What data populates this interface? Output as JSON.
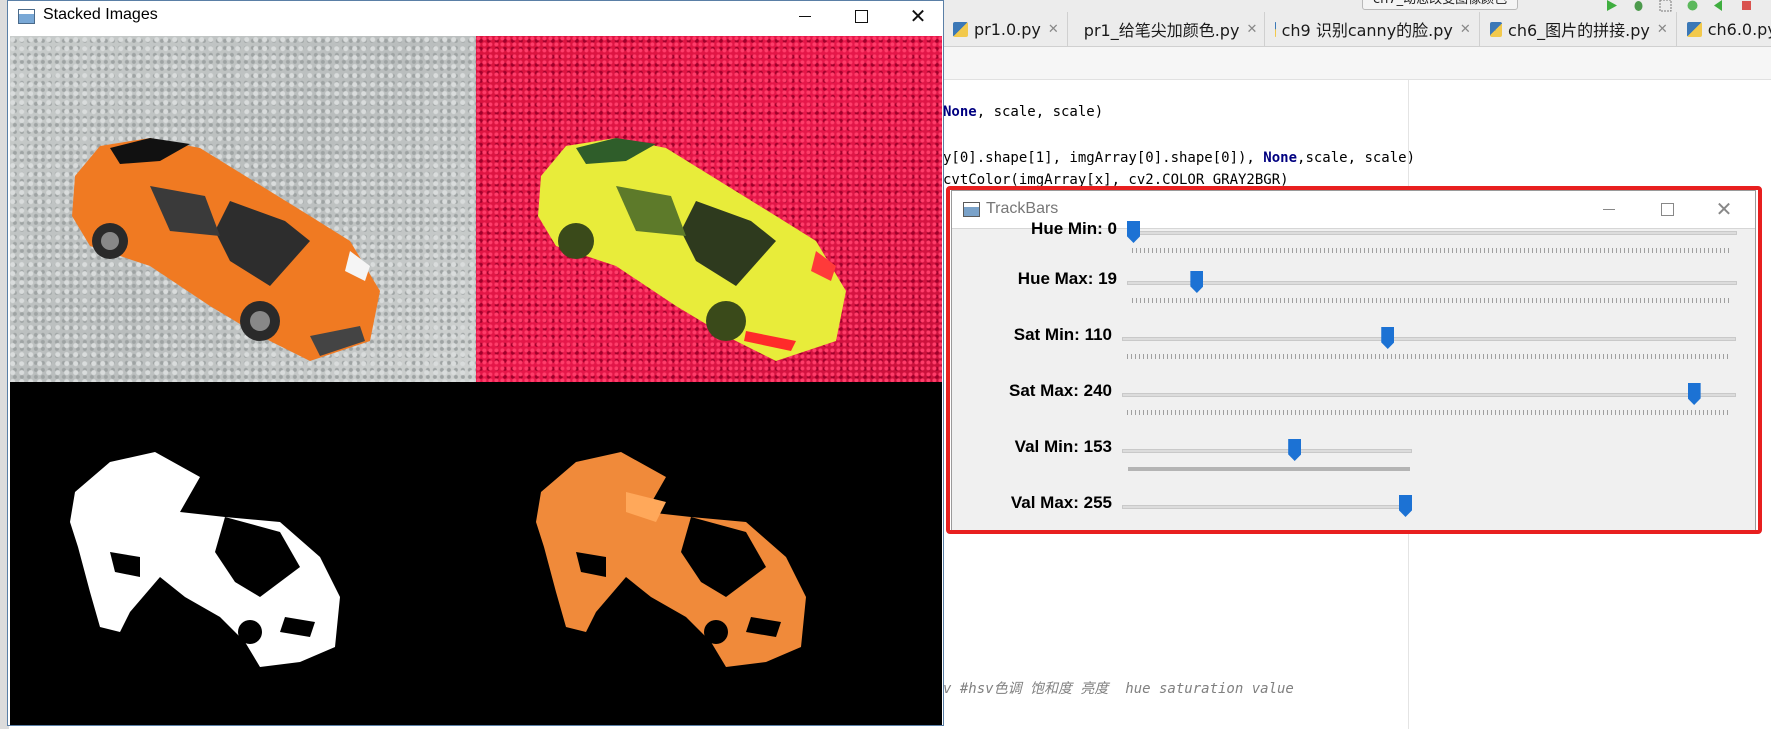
{
  "ide": {
    "run_config": "ch7_动态改变图像颜色",
    "tabs": [
      {
        "label": "pr1.0.py"
      },
      {
        "label": "pr1_给笔尖加颜色.py"
      },
      {
        "label": "ch9 识别canny的脸.py"
      },
      {
        "label": "ch6_图片的拼接.py"
      },
      {
        "label": "ch6.0.py"
      }
    ],
    "code": {
      "line1_kw": "None",
      "line1_rest": ", scale, scale)",
      "line2_pre": "y[0].shape[1], imgArray[0].shape[0]), ",
      "line2_kw": "None",
      "line2_post": ",scale, scale)",
      "line3": "cvtColor(imgArray[x], cv2.COLOR_GRAY2BGR)",
      "comment": "v #hsv色调 饱和度 亮度  hue saturation value"
    }
  },
  "stacked_window": {
    "title": "Stacked Images"
  },
  "trackbars_window": {
    "title": "TrackBars",
    "sliders": [
      {
        "label": "Hue Min: 0",
        "value": 0,
        "max": 179
      },
      {
        "label": "Hue Max: 19",
        "value": 19,
        "max": 179
      },
      {
        "label": "Sat Min: 110",
        "value": 110,
        "max": 255
      },
      {
        "label": "Sat Max: 240",
        "value": 240,
        "max": 255
      },
      {
        "label": "Val Min: 153",
        "value": 153,
        "max": 255
      },
      {
        "label": "Val Max: 255",
        "value": 255,
        "max": 255
      }
    ],
    "thumb_color": "#1c72d4",
    "highlight_color": "#e81f1f"
  }
}
